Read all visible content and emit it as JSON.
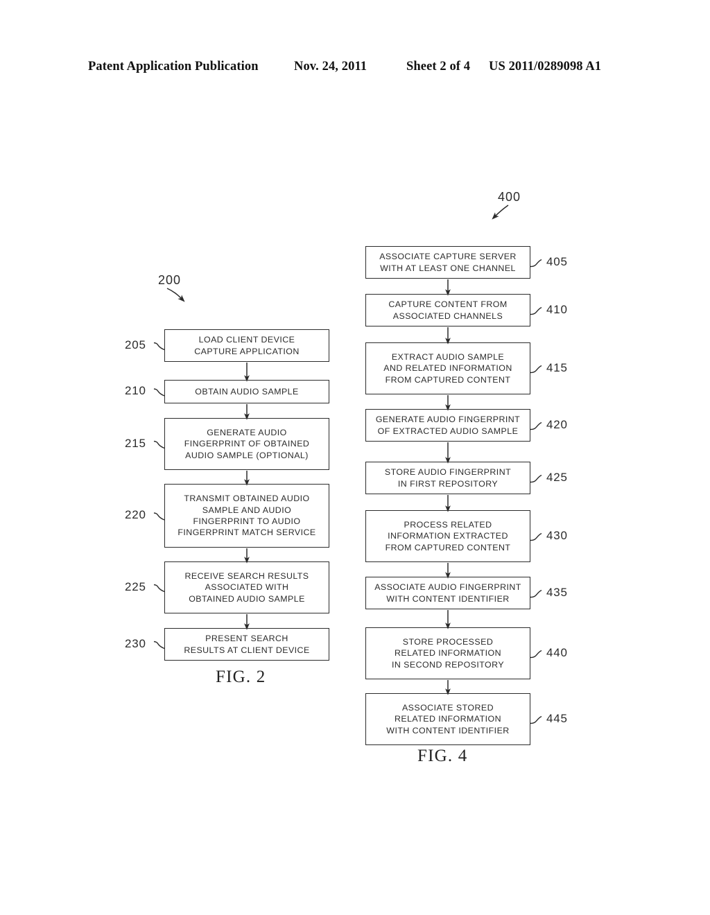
{
  "header": {
    "title": "Patent Application Publication",
    "date": "Nov. 24, 2011",
    "sheet": "Sheet 2 of 4",
    "publication_number": "US 2011/0289098 A1"
  },
  "figures": [
    {
      "id": "figure-2",
      "caption": "FIG. 2",
      "flow_label": "200",
      "ref_side": "left",
      "steps": [
        {
          "ref": "205",
          "text": "LOAD CLIENT DEVICE\nCAPTURE APPLICATION"
        },
        {
          "ref": "210",
          "text": "OBTAIN AUDIO SAMPLE"
        },
        {
          "ref": "215",
          "text": "GENERATE AUDIO\nFINGERPRINT OF OBTAINED\nAUDIO SAMPLE (OPTIONAL)"
        },
        {
          "ref": "220",
          "text": "TRANSMIT OBTAINED AUDIO\nSAMPLE AND AUDIO\nFINGERPRINT TO AUDIO\nFINGERPRINT MATCH SERVICE"
        },
        {
          "ref": "225",
          "text": "RECEIVE SEARCH RESULTS\nASSOCIATED WITH\nOBTAINED AUDIO SAMPLE"
        },
        {
          "ref": "230",
          "text": "PRESENT SEARCH\nRESULTS AT CLIENT DEVICE"
        }
      ]
    },
    {
      "id": "figure-4",
      "caption": "FIG. 4",
      "flow_label": "400",
      "ref_side": "right",
      "steps": [
        {
          "ref": "405",
          "text": "ASSOCIATE CAPTURE SERVER\nWITH AT LEAST ONE CHANNEL"
        },
        {
          "ref": "410",
          "text": "CAPTURE CONTENT FROM\nASSOCIATED CHANNELS"
        },
        {
          "ref": "415",
          "text": "EXTRACT AUDIO SAMPLE\nAND RELATED INFORMATION\nFROM CAPTURED CONTENT"
        },
        {
          "ref": "420",
          "text": "GENERATE AUDIO FINGERPRINT\nOF EXTRACTED AUDIO SAMPLE"
        },
        {
          "ref": "425",
          "text": "STORE AUDIO FINGERPRINT\nIN FIRST REPOSITORY"
        },
        {
          "ref": "430",
          "text": "PROCESS RELATED\nINFORMATION EXTRACTED\nFROM CAPTURED CONTENT"
        },
        {
          "ref": "435",
          "text": "ASSOCIATE AUDIO FINGERPRINT\nWITH CONTENT IDENTIFIER"
        },
        {
          "ref": "440",
          "text": "STORE PROCESSED\nRELATED INFORMATION\nIN SECOND REPOSITORY"
        },
        {
          "ref": "445",
          "text": "ASSOCIATE STORED\nRELATED INFORMATION\nWITH CONTENT IDENTIFIER"
        }
      ]
    }
  ],
  "colors": {
    "ink": "#2b2b2b",
    "page": "#ffffff"
  }
}
